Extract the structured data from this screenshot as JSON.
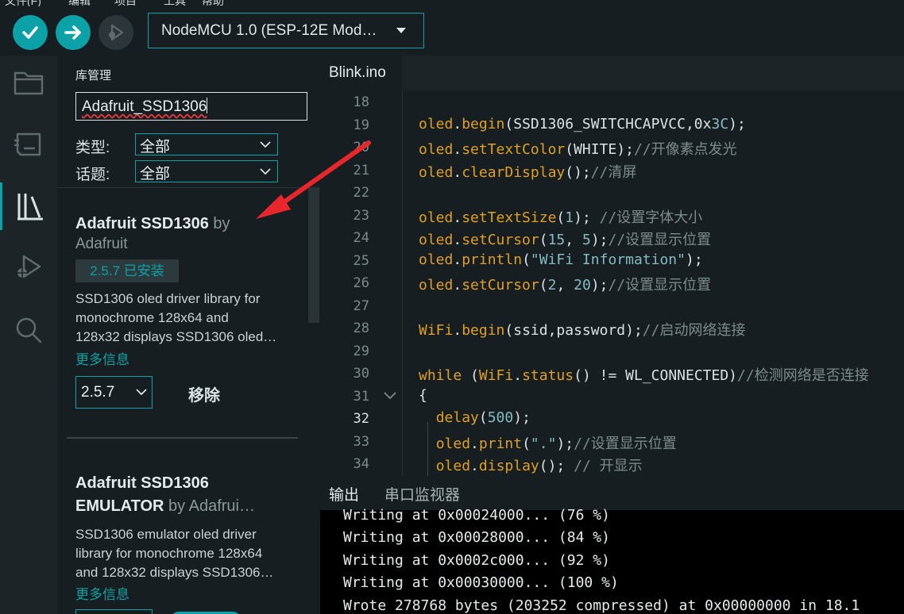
{
  "menubar": {
    "items": [
      "文件(F)",
      "编辑",
      "项目",
      "工具",
      "帮助"
    ]
  },
  "toolbar": {
    "verify_icon": "check-icon",
    "upload_icon": "arrow-right-icon",
    "debug_icon": "debug-icon",
    "board_label": "NodeMCU 1.0 (ESP-12E Mod…"
  },
  "sidenav": {
    "items": [
      "folder-icon",
      "board-manager-icon",
      "library-icon",
      "debug-icon",
      "search-icon"
    ],
    "active": "library-icon"
  },
  "library": {
    "title": "库管理",
    "search_value": "Adafruit_SSD1306",
    "filters": [
      {
        "label": "类型:",
        "value": "全部"
      },
      {
        "label": "话题:",
        "value": "全部"
      }
    ],
    "items": [
      {
        "name": "Adafruit SSD1306",
        "by": "by",
        "author": "Adafruit",
        "installed_badge": "2.5.7 已安装",
        "description": [
          "SSD1306 oled driver library for",
          "monochrome 128x64 and",
          "128x32 displays SSD1306 oled…"
        ],
        "more": "更多信息",
        "version": "2.5.7",
        "action": "移除"
      },
      {
        "name_line1": "Adafruit SSD1306",
        "name_line2": "EMULATOR",
        "author": "by Adafrui…",
        "description": [
          "SSD1306 emulator oled driver",
          "library for monochrome 128x64",
          "and 128x32 displays SSD1306…"
        ],
        "more": "更多信息"
      }
    ]
  },
  "editor": {
    "tab": "Blink.ino",
    "current_line": 32,
    "line_numbers": [
      "18",
      "19",
      "20",
      "21",
      "22",
      "23",
      "24",
      "25",
      "26",
      "27",
      "28",
      "29",
      "30",
      "31",
      "32",
      "33",
      "34"
    ]
  },
  "output": {
    "tabs": [
      "输出",
      "串口监视器"
    ],
    "active_tab": "输出",
    "lines": [
      "Writing at 0x00024000... (76 %)",
      "Writing at 0x00028000... (84 %)",
      "Writing at 0x0002c000... (92 %)",
      "Writing at 0x00030000... (100 %)",
      "Wrote 278768 bytes (203252 compressed) at 0x00000000 in 18.1"
    ]
  },
  "colors": {
    "accent": "#0ca1a6",
    "background": "#171e21",
    "code_keyword": "#e09f25",
    "code_number": "#83bcbf",
    "code_comment": "#7c8b8c",
    "code_string": "#83bcbf",
    "annotation_arrow": "#e8262b"
  }
}
